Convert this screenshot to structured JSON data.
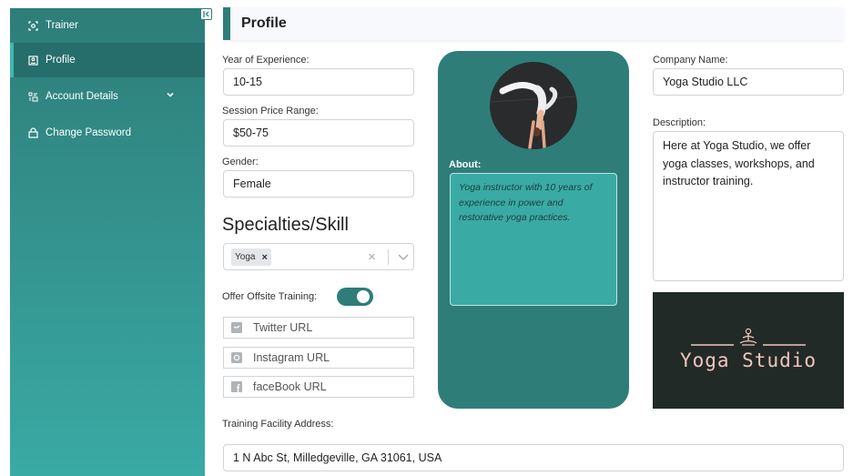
{
  "sidebar": {
    "items": [
      {
        "label": "Trainer",
        "icon": "trainer-icon"
      },
      {
        "label": "Profile",
        "icon": "profile-icon"
      },
      {
        "label": "Account Details",
        "icon": "account-icon"
      },
      {
        "label": "Change Password",
        "icon": "lock-icon"
      }
    ]
  },
  "header": {
    "title": "Profile"
  },
  "form": {
    "experience_label": "Year of Experience:",
    "experience_value": "10-15",
    "price_label": "Session Price Range:",
    "price_value": "$50-75",
    "gender_label": "Gender:",
    "gender_value": "Female",
    "specialties_title": "Specialties/Skill",
    "specialties_chip": "Yoga",
    "chip_remove": "×",
    "clear_symbol": "×",
    "offsite_label": "Offer Offsite Training:",
    "offsite_enabled": true,
    "twitter_placeholder": "Twitter URL",
    "instagram_placeholder": "Instagram URL",
    "facebook_placeholder": "faceBook URL",
    "address_label": "Training Facility Address:",
    "address_value": "1 N Abc St, Milledgeville, GA 31061, USA"
  },
  "about": {
    "label": "About:",
    "text": "Yoga instructor with 10 years of experience in power and restorative yoga practices."
  },
  "company": {
    "name_label": "Company Name:",
    "name_value": "Yoga Studio LLC",
    "description_label": "Description:",
    "description_value": "Here at Yoga Studio, we offer yoga classes, workshops, and instructor training.",
    "logo_text": "Yoga Studio"
  },
  "colors": {
    "primary": "#2e7d79",
    "sidebar_gradient_end": "#3aaaa4",
    "logo_bg": "#212a26",
    "logo_text": "#f2c4c0"
  }
}
